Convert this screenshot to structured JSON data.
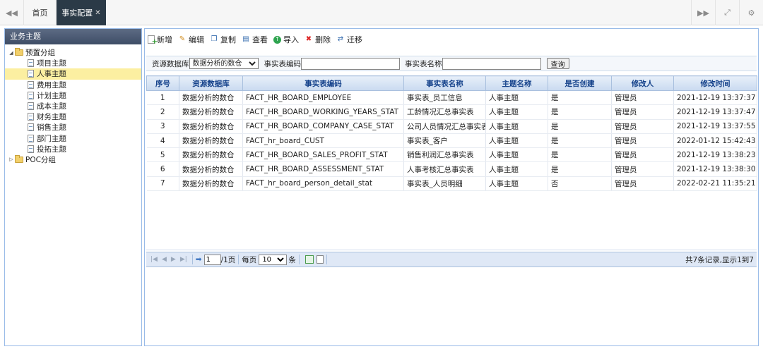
{
  "tabs": [
    {
      "label": "首页"
    },
    {
      "label": "事实配置",
      "close": "✕"
    }
  ],
  "sidebar": {
    "title": "业务主题",
    "tree": [
      {
        "label": "预置分组",
        "type": "folder",
        "expanded": true
      },
      {
        "label": "项目主题",
        "type": "leaf"
      },
      {
        "label": "人事主题",
        "type": "leaf",
        "selected": true
      },
      {
        "label": "费用主题",
        "type": "leaf"
      },
      {
        "label": "计划主题",
        "type": "leaf"
      },
      {
        "label": "成本主题",
        "type": "leaf"
      },
      {
        "label": "财务主题",
        "type": "leaf"
      },
      {
        "label": "销售主题",
        "type": "leaf"
      },
      {
        "label": "部门主题",
        "type": "leaf"
      },
      {
        "label": "投拓主题",
        "type": "leaf"
      },
      {
        "label": "POC分组",
        "type": "folder",
        "expanded": false
      }
    ]
  },
  "toolbar": {
    "new": "新增",
    "edit": "编辑",
    "copy": "复制",
    "view": "查看",
    "import": "导入",
    "delete": "删除",
    "migrate": "迁移"
  },
  "search": {
    "db_label": "资源数据库",
    "db_value": "数据分析的数仓",
    "code_label": "事实表编码",
    "code_value": "",
    "name_label": "事实表名称",
    "name_value": "",
    "button": "查询"
  },
  "table": {
    "columns": [
      "序号",
      "资源数据库",
      "事实表编码",
      "事实表名称",
      "主题名称",
      "是否创建",
      "修改人",
      "修改时间"
    ],
    "rows": [
      [
        "1",
        "数据分析的数仓",
        "FACT_HR_BOARD_EMPLOYEE",
        "事实表_员工信息",
        "人事主题",
        "是",
        "管理员",
        "2021-12-19 13:37:37"
      ],
      [
        "2",
        "数据分析的数仓",
        "FACT_HR_BOARD_WORKING_YEARS_STAT",
        "工龄情况汇总事实表",
        "人事主题",
        "是",
        "管理员",
        "2021-12-19 13:37:47"
      ],
      [
        "3",
        "数据分析的数仓",
        "FACT_HR_BOARD_COMPANY_CASE_STAT",
        "公司人员情况汇总事实表",
        "人事主题",
        "是",
        "管理员",
        "2021-12-19 13:37:55"
      ],
      [
        "4",
        "数据分析的数仓",
        "FACT_hr_board_CUST",
        "事实表_客户",
        "人事主题",
        "是",
        "管理员",
        "2022-01-12 15:42:43"
      ],
      [
        "5",
        "数据分析的数仓",
        "FACT_HR_BOARD_SALES_PROFIT_STAT",
        "销售利润汇总事实表",
        "人事主题",
        "是",
        "管理员",
        "2021-12-19 13:38:23"
      ],
      [
        "6",
        "数据分析的数仓",
        "FACT_HR_BOARD_ASSESSMENT_STAT",
        "人事考核汇总事实表",
        "人事主题",
        "是",
        "管理员",
        "2021-12-19 13:38:30"
      ],
      [
        "7",
        "数据分析的数仓",
        "FACT_hr_board_person_detail_stat",
        "事实表_人员明细",
        "人事主题",
        "否",
        "管理员",
        "2022-02-21 11:35:21"
      ]
    ]
  },
  "pager": {
    "page": "1",
    "total_pages": "/1页",
    "per_page_label": "每页",
    "per_page": "10",
    "per_page_unit": "条",
    "info": "共7条记录,显示1到7"
  },
  "colors": {
    "active_tab": "#2b3a47",
    "panel_border": "#99bbe8",
    "header_text": "#15428b",
    "selected_node": "#fcefa1"
  }
}
